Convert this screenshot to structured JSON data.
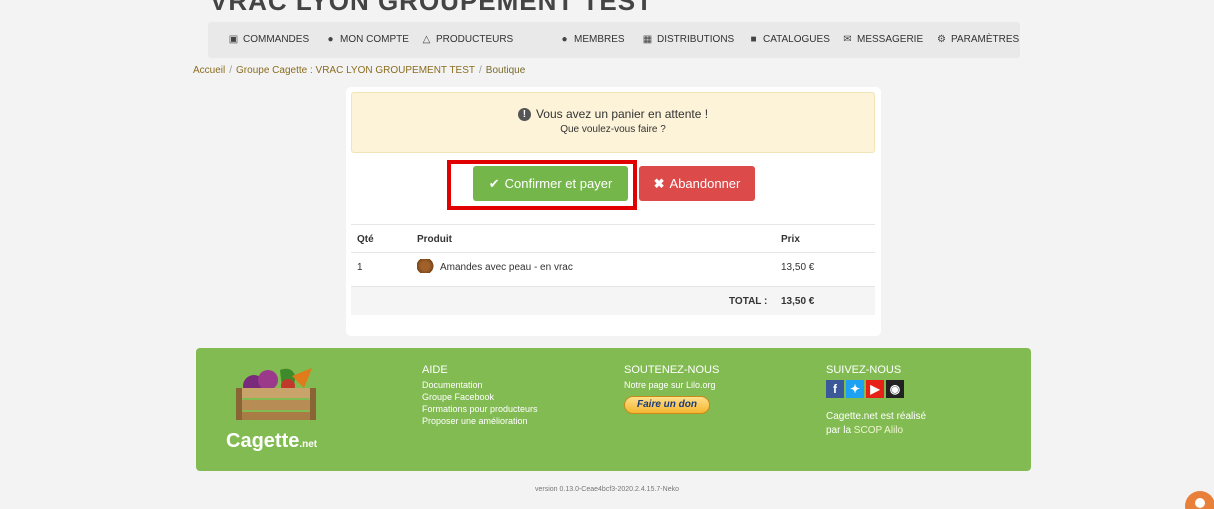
{
  "page": {
    "title_partial": "VRAC LYON GROUPEMENT TEST"
  },
  "nav": {
    "items": [
      {
        "label": "COMMANDES",
        "icon": "basket-icon"
      },
      {
        "label": "MON COMPTE",
        "icon": "user-icon"
      },
      {
        "label": "PRODUCTEURS",
        "icon": "farmer-icon"
      },
      {
        "label": "MEMBRES",
        "icon": "users-icon"
      },
      {
        "label": "DISTRIBUTIONS",
        "icon": "calendar-icon"
      },
      {
        "label": "CATALOGUES",
        "icon": "book-icon"
      },
      {
        "label": "MESSAGERIE",
        "icon": "envelope-icon"
      },
      {
        "label": "PARAMÈTRES",
        "icon": "gear-icon"
      }
    ]
  },
  "breadcrumb": {
    "home": "Accueil",
    "group": "Groupe Cagette : VRAC LYON GROUPEMENT TEST",
    "current": "Boutique"
  },
  "alert": {
    "title": "Vous avez un panier en attente !",
    "subtitle": "Que voulez-vous faire ?"
  },
  "actions": {
    "confirm_label": "Confirmer et payer",
    "abandon_label": "Abandonner"
  },
  "cart": {
    "headers": {
      "qty": "Qté",
      "product": "Produit",
      "price": "Prix"
    },
    "rows": [
      {
        "qty": "1",
        "product": "Amandes avec peau - en vrac",
        "price": "13,50 €"
      }
    ],
    "total_label": "TOTAL :",
    "total_value": "13,50 €"
  },
  "footer": {
    "logo_main": "Cagette",
    "logo_suffix": ".net",
    "help": {
      "title": "AIDE",
      "links": [
        "Documentation",
        "Groupe Facebook",
        "Formations pour producteurs",
        "Proposer une amélioration"
      ]
    },
    "support": {
      "title": "SOUTENEZ-NOUS",
      "text": "Notre page sur Lilo.org",
      "donate_label": "Faire un don"
    },
    "follow": {
      "title": "SUIVEZ-NOUS",
      "credit_line1": "Cagette.net est réalisé",
      "credit_prefix": "par la",
      "credit_link": "SCOP Alilo"
    }
  },
  "version": "version 0.13.0-Ceae4bcf3-2020.2.4.15.7-Neko",
  "colors": {
    "confirm": "#74b64a",
    "abandon": "#dc4a4a",
    "footer": "#82bb52",
    "highlight": "#e00000"
  }
}
